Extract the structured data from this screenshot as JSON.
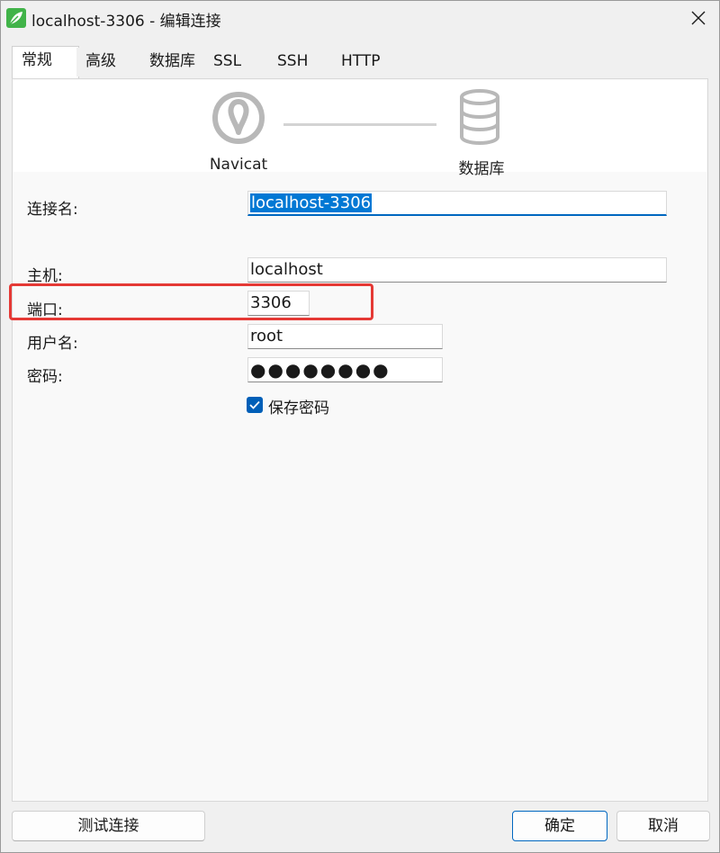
{
  "window": {
    "title": "localhost-3306 - 编辑连接",
    "app_icon": "navicat-leaf-icon",
    "close_icon": "close-icon"
  },
  "tabs": [
    {
      "label": "常规",
      "active": true
    },
    {
      "label": "高级",
      "active": false
    },
    {
      "label": "数据库",
      "active": false
    },
    {
      "label": "SSL",
      "active": false
    },
    {
      "label": "SSH",
      "active": false
    },
    {
      "label": "HTTP",
      "active": false
    }
  ],
  "banner": {
    "left_label": "Navicat",
    "right_label": "数据库",
    "left_icon": "navicat-logo-icon",
    "right_icon": "database-icon"
  },
  "form": {
    "connection_name": {
      "label": "连接名:",
      "value": "localhost-3306"
    },
    "host": {
      "label": "主机:",
      "value": "localhost"
    },
    "port": {
      "label": "端口:",
      "value": "3306"
    },
    "username": {
      "label": "用户名:",
      "value": "root"
    },
    "password": {
      "label": "密码:",
      "value": "●●●●●●●●"
    },
    "save_password": {
      "label": "保存密码",
      "checked": true
    }
  },
  "buttons": {
    "test": "测试连接",
    "ok": "确定",
    "cancel": "取消"
  },
  "colors": {
    "accent": "#0067c0",
    "selection": "#0078d4",
    "highlight_border": "#e53935",
    "app_icon": "#41b349"
  }
}
